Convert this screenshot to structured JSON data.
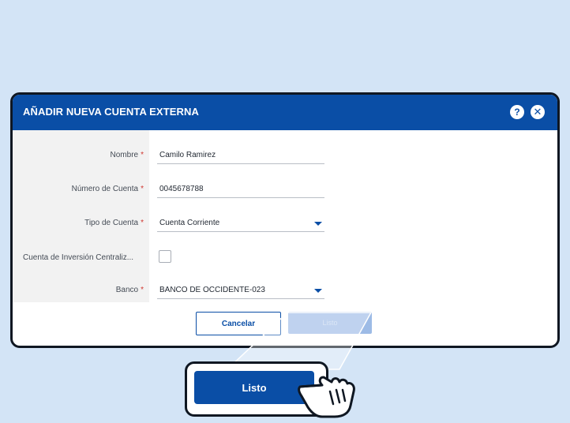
{
  "dialog": {
    "title": "AÑADIR NUEVA CUENTA EXTERNA",
    "help_icon": "?",
    "close_icon": "✕"
  },
  "form": {
    "required_mark": "*",
    "nombre": {
      "label": "Nombre",
      "value": "Camilo Ramirez"
    },
    "numero_cuenta": {
      "label": "Número de Cuenta",
      "value": "0045678788"
    },
    "tipo_cuenta": {
      "label": "Tipo de Cuenta",
      "value": "Cuenta Corriente"
    },
    "inversion": {
      "label": "Cuenta de Inversión Centraliz...",
      "checked": false
    },
    "banco": {
      "label": "Banco",
      "value": "BANCO DE OCCIDENTE-023"
    }
  },
  "actions": {
    "cancel_label": "Cancelar",
    "done_label": "Listo"
  },
  "colors": {
    "background": "#d3e4f6",
    "header": "#0a4ea6",
    "required": "#d0362f"
  },
  "icons": {
    "help": "help-icon",
    "close": "close-icon",
    "dropdown": "chevron-down-icon",
    "pointer": "hand-pointer-icon"
  }
}
